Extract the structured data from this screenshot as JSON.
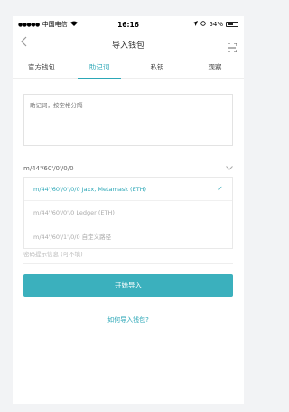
{
  "status_bar": {
    "carrier": "中国电信",
    "time": "16:16",
    "battery": "54%"
  },
  "nav": {
    "title": "导入钱包"
  },
  "tabs": [
    {
      "label": "官方钱包"
    },
    {
      "label": "助记词"
    },
    {
      "label": "私钥"
    },
    {
      "label": "观察"
    }
  ],
  "mnemonic": {
    "placeholder": "助记词，按空格分隔"
  },
  "path": {
    "current": "m/44'/60'/0'/0/0",
    "options": [
      {
        "label": "m/44'/60'/0'/0/0 Jaxx, Metamask (ETH)"
      },
      {
        "label": "m/44'/60'/0'/0 Ledger (ETH)"
      },
      {
        "label": "m/44'/60'/1'/0/0 自定义路径"
      }
    ]
  },
  "password_hint": {
    "placeholder": "密码提示信息 (可不填)"
  },
  "start_button": {
    "label": "开始导入"
  },
  "howto_link": {
    "label": "如何导入钱包?"
  },
  "colors": {
    "accent": "#2ca7b7",
    "button": "#3bb0bd"
  }
}
